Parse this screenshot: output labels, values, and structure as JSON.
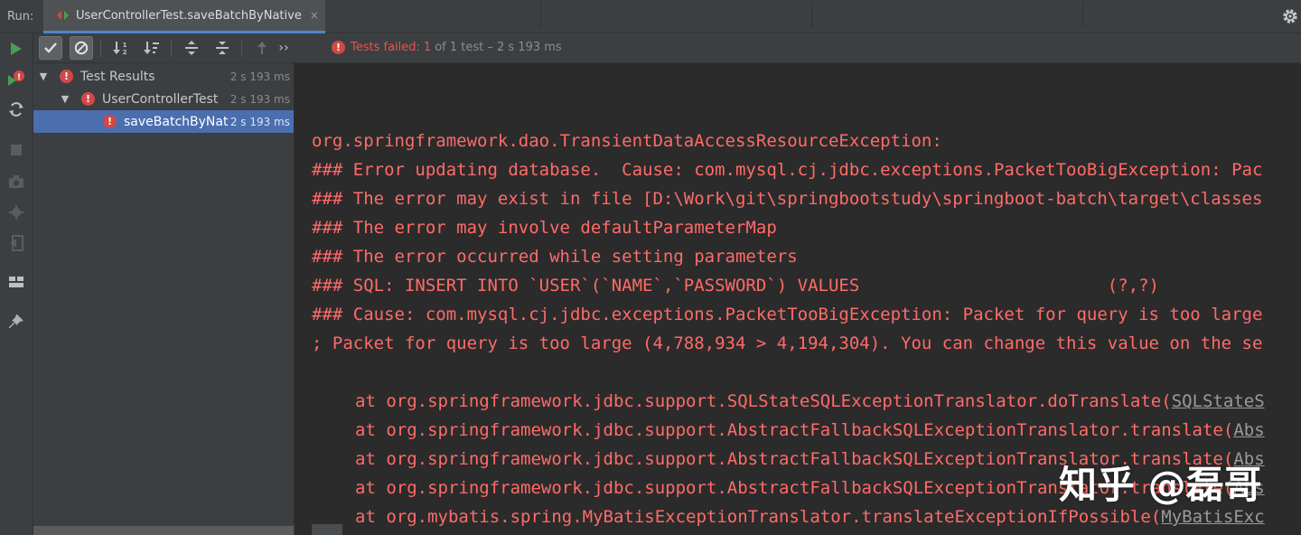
{
  "run_tab": {
    "run_label": "Run:",
    "tab_title": "UserControllerTest.saveBatchByNative",
    "close_glyph": "×"
  },
  "status_bar": {
    "failed_label": "Tests failed:",
    "failed_count": "1",
    "summary": "of 1 test – 2 s 193 ms",
    "more_glyph": "››"
  },
  "test_tree": [
    {
      "label": "Test Results",
      "time": "2 s 193 ms",
      "level": 0,
      "expanded": true,
      "status": "failed",
      "selected": false
    },
    {
      "label": "UserControllerTest",
      "time": "2 s 193 ms",
      "level": 1,
      "expanded": true,
      "status": "failed",
      "selected": false
    },
    {
      "label": "saveBatchByNative",
      "time": "2 s 193 ms",
      "level": 2,
      "expanded": false,
      "status": "failed",
      "selected": true
    }
  ],
  "console": {
    "lines": [
      "org.springframework.dao.TransientDataAccessResourceException:",
      "### Error updating database.  Cause: com.mysql.cj.jdbc.exceptions.PacketTooBigException: Pac",
      "### The error may exist in file [D:\\Work\\git\\springbootstudy\\springboot-batch\\target\\classes",
      "### The error may involve defaultParameterMap",
      "### The error occurred while setting parameters",
      "### SQL: INSERT INTO `USER`(`NAME`,`PASSWORD`) VALUES                        (?,?)",
      "### Cause: com.mysql.cj.jdbc.exceptions.PacketTooBigException: Packet for query is too large",
      "; Packet for query is too large (4,788,934 > 4,194,304). You can change this value on the se",
      ""
    ],
    "stack": [
      {
        "text": "at org.springframework.jdbc.support.SQLStateSQLExceptionTranslator.doTranslate(",
        "link": "SQLStateS"
      },
      {
        "text": "at org.springframework.jdbc.support.AbstractFallbackSQLExceptionTranslator.translate(",
        "link": "Abs"
      },
      {
        "text": "at org.springframework.jdbc.support.AbstractFallbackSQLExceptionTranslator.translate(",
        "link": "Abs"
      },
      {
        "text": "at org.springframework.jdbc.support.AbstractFallbackSQLExceptionTranslator.translate(",
        "link": "Abs"
      },
      {
        "text": "at org.mybatis.spring.MyBatisExceptionTranslator.translateExceptionIfPossible(",
        "link": "MyBatisExc"
      }
    ]
  },
  "watermark": "知乎 @磊哥",
  "colors": {
    "error_text": "#ff6b68",
    "selection": "#4b6eaf",
    "panel": "#3c3f41",
    "editor": "#2b2b2b",
    "run_green": "#499c54",
    "error_badge": "#d14848"
  },
  "icons": {
    "left_toolbar": [
      "run-icon",
      "rerun-failed-icon",
      "toggle-auto-test-icon",
      "stop-icon",
      "screenshot-icon",
      "debug-settings-icon",
      "exit-icon",
      "layout-icon",
      "pin-icon"
    ],
    "test_toolbar": [
      "show-passed-icon",
      "show-ignored-icon",
      "sort-alpha-icon",
      "sort-duration-icon",
      "expand-all-icon",
      "collapse-all-icon",
      "previous-failed-icon",
      "more-icon"
    ]
  }
}
